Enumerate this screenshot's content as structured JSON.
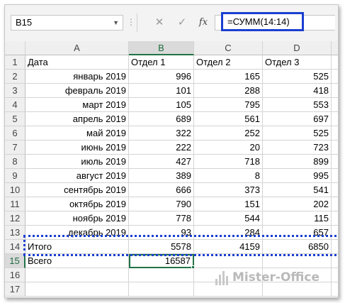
{
  "formula_bar": {
    "name_box": "B15",
    "cancel_icon": "✕",
    "enter_icon": "✓",
    "fx_label": "fx",
    "formula": "=СУММ(14:14)"
  },
  "columns": [
    "A",
    "B",
    "C",
    "D"
  ],
  "rows": [
    {
      "n": "1",
      "a": "Дата",
      "b": "Отдел 1",
      "c": "Отдел 2",
      "d": "Отдел 3"
    },
    {
      "n": "2",
      "a": "январь 2019",
      "b": "996",
      "c": "165",
      "d": "525"
    },
    {
      "n": "3",
      "a": "февраль 2019",
      "b": "101",
      "c": "288",
      "d": "418"
    },
    {
      "n": "4",
      "a": "март 2019",
      "b": "105",
      "c": "795",
      "d": "553"
    },
    {
      "n": "5",
      "a": "апрель 2019",
      "b": "689",
      "c": "561",
      "d": "697"
    },
    {
      "n": "6",
      "a": "май 2019",
      "b": "322",
      "c": "252",
      "d": "525"
    },
    {
      "n": "7",
      "a": "июнь 2019",
      "b": "222",
      "c": "20",
      "d": "723"
    },
    {
      "n": "8",
      "a": "июль 2019",
      "b": "427",
      "c": "718",
      "d": "899"
    },
    {
      "n": "9",
      "a": "август 2019",
      "b": "389",
      "c": "8",
      "d": "995"
    },
    {
      "n": "10",
      "a": "сентябрь 2019",
      "b": "666",
      "c": "373",
      "d": "541"
    },
    {
      "n": "11",
      "a": "октябрь 2019",
      "b": "790",
      "c": "151",
      "d": "202"
    },
    {
      "n": "12",
      "a": "ноябрь 2019",
      "b": "778",
      "c": "544",
      "d": "115"
    },
    {
      "n": "13",
      "a": "декабрь 2019",
      "b": "93",
      "c": "284",
      "d": "657"
    },
    {
      "n": "14",
      "a": "Итого",
      "b": "5578",
      "c": "4159",
      "d": "6850"
    },
    {
      "n": "15",
      "a": "Всего",
      "b": "16587",
      "c": "",
      "d": ""
    },
    {
      "n": "16",
      "a": "",
      "b": "",
      "c": "",
      "d": ""
    },
    {
      "n": "17",
      "a": "",
      "b": "",
      "c": "",
      "d": ""
    }
  ],
  "selection": {
    "column": "B",
    "row": "15"
  },
  "watermark": "Mister-Office",
  "colors": {
    "selection_green": "#217346",
    "highlight_blue": "#1a3fd0"
  }
}
